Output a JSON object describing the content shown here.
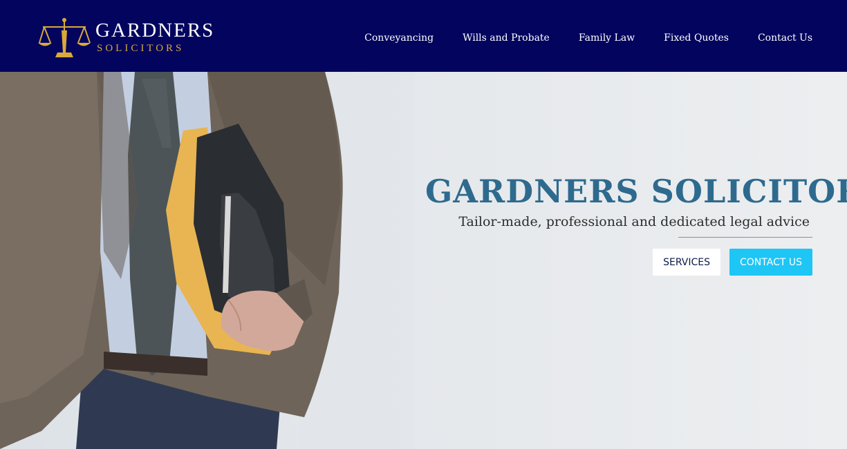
{
  "brand": {
    "name": "GARDNERS",
    "sub": "SOLICITORS",
    "logo_icon": "scales-of-justice-icon",
    "colors": {
      "header_bg": "#03045e",
      "logo_gold": "#d9a93a",
      "title_blue": "#2e6a8e",
      "contact_button": "#1ec6f5"
    }
  },
  "nav": {
    "items": [
      {
        "label": "Conveyancing"
      },
      {
        "label": "Wills and Probate"
      },
      {
        "label": "Family Law"
      },
      {
        "label": "Fixed Quotes"
      },
      {
        "label": "Contact Us"
      }
    ]
  },
  "hero": {
    "title": "GARDNERS SOLICITORS",
    "tagline": "Tailor-made, professional and dedicated legal advice",
    "services_label": "SERVICES",
    "contact_label": "CONTACT US"
  }
}
